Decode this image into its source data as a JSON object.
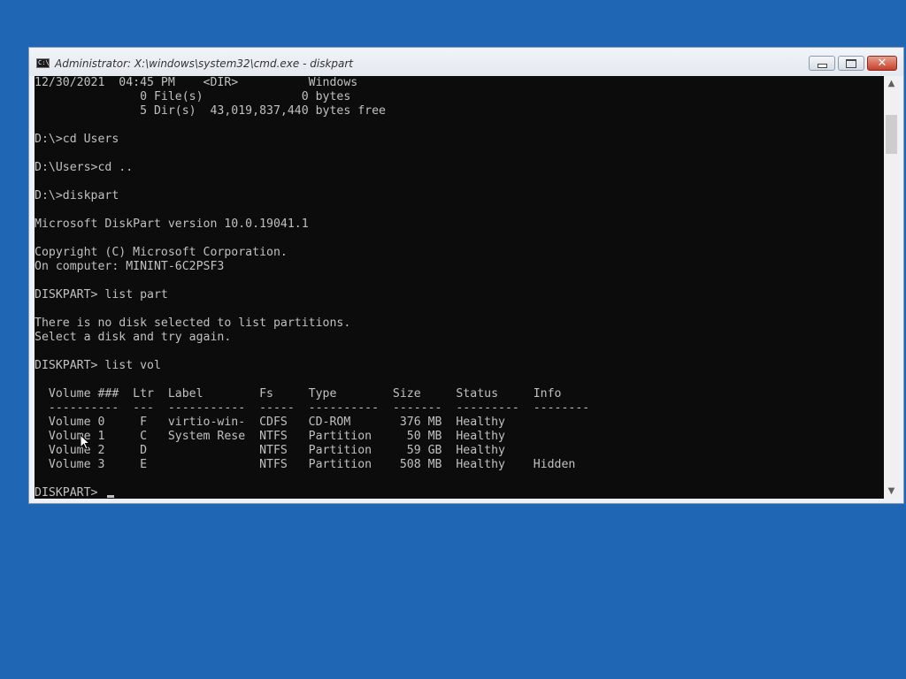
{
  "window": {
    "title": "Administrator: X:\\windows\\system32\\cmd.exe - diskpart",
    "icon_label": "C:\\"
  },
  "console": {
    "lines": [
      "12/30/2021  04:45 PM    <DIR>          Windows",
      "               0 File(s)              0 bytes",
      "               5 Dir(s)  43,019,837,440 bytes free",
      "",
      "D:\\>cd Users",
      "",
      "D:\\Users>cd ..",
      "",
      "D:\\>diskpart",
      "",
      "Microsoft DiskPart version 10.0.19041.1",
      "",
      "Copyright (C) Microsoft Corporation.",
      "On computer: MININT-6C2PSF3",
      "",
      "DISKPART> list part",
      "",
      "There is no disk selected to list partitions.",
      "Select a disk and try again.",
      "",
      "DISKPART> list vol",
      "",
      "  Volume ###  Ltr  Label        Fs     Type        Size     Status     Info",
      "  ----------  ---  -----------  -----  ----------  -------  ---------  --------",
      "  Volume 0     F   virtio-win-  CDFS   CD-ROM       376 MB  Healthy",
      "  Volume 1     C   System Rese  NTFS   Partition     50 MB  Healthy",
      "  Volume 2     D                NTFS   Partition     59 GB  Healthy",
      "  Volume 3     E                NTFS   Partition    508 MB  Healthy    Hidden",
      "",
      "DISKPART> "
    ]
  },
  "icons": {
    "minimize": "minimize-icon",
    "maximize": "maximize-icon",
    "close": "close-icon",
    "scroll_up": "scroll-up-icon",
    "scroll_down": "scroll-down-icon",
    "pointer": "mouse-pointer-icon"
  },
  "colors": {
    "desktop": "#1f66b4",
    "console_bg": "#0c0c0c",
    "console_fg": "#c0c0c0",
    "close_button": "#c6402a"
  }
}
